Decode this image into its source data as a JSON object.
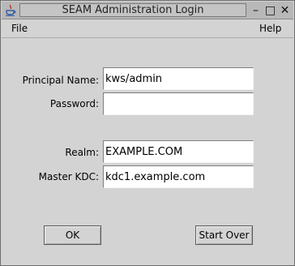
{
  "window": {
    "title": "SEAM Administration Login",
    "controls": {
      "minimize": "–",
      "maximize": "□",
      "close": "✕"
    }
  },
  "menubar": {
    "file": "File",
    "help": "Help"
  },
  "form": {
    "principal_label": "Principal Name:",
    "principal_value": "kws/admin",
    "password_label": "Password:",
    "password_value": "",
    "realm_label": "Realm:",
    "realm_value": "EXAMPLE.COM",
    "kdc_label": "Master KDC:",
    "kdc_value": "kdc1.example.com"
  },
  "buttons": {
    "ok": "OK",
    "start_over": "Start Over"
  },
  "icons": {
    "app": "java-cup-icon"
  }
}
